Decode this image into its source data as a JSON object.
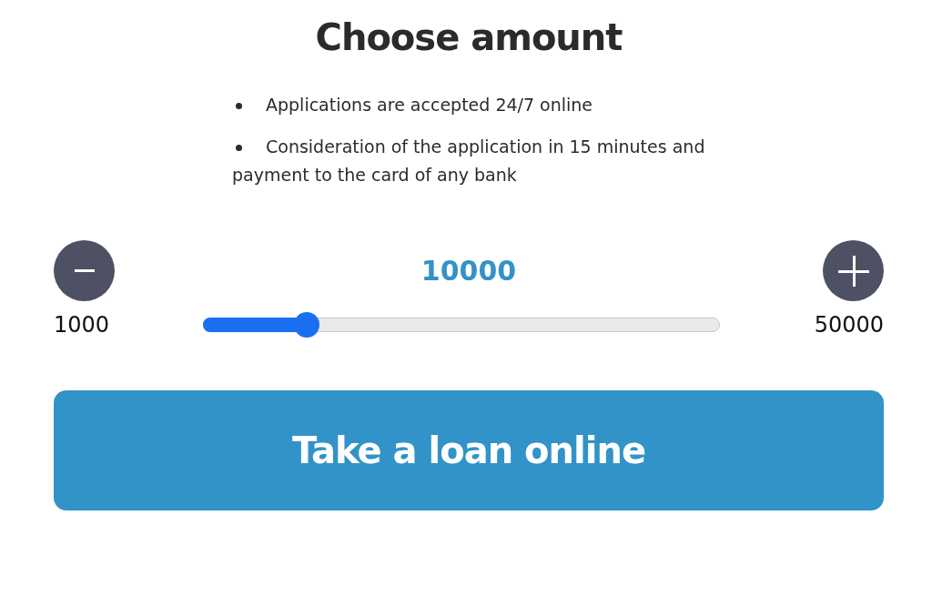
{
  "title": "Choose amount",
  "features": [
    "Applications are accepted 24/7 online",
    "Consideration of the application in 15 minutes and payment to the card of any bank"
  ],
  "amount": {
    "value": "10000",
    "min": "1000",
    "max": "50000",
    "level": 0.2
  },
  "submit": "Take a loan online"
}
